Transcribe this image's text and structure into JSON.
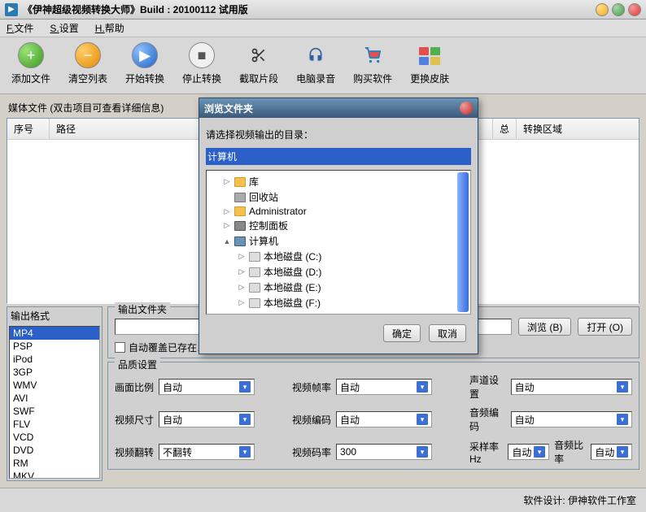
{
  "title": "《伊神超级视频转换大师》Build : 20100112 试用版",
  "menu": {
    "file": "文件",
    "settings": "设置",
    "help": "帮助",
    "f": "F.",
    "s": "S.",
    "h": "H."
  },
  "toolbar": {
    "add": "添加文件",
    "clear": "清空列表",
    "start": "开始转换",
    "stop": "停止转换",
    "cut": "截取片段",
    "record": "电脑录音",
    "buy": "购买软件",
    "skin": "更换皮肤"
  },
  "media": {
    "label": "媒体文件 (双击项目可查看详细信息)",
    "cols": {
      "c1": "序号",
      "c2": "路径",
      "c5": "总",
      "c6": "转换区域"
    }
  },
  "formats": {
    "title": "输出格式",
    "items": [
      "MP4",
      "PSP",
      "iPod",
      "3GP",
      "WMV",
      "AVI",
      "SWF",
      "FLV",
      "VCD",
      "DVD",
      "RM",
      "MKV"
    ],
    "selected": "MP4"
  },
  "output": {
    "group": "输出文件夹",
    "browse": "浏览 (B)",
    "open": "打开 (O)",
    "overwrite": "自动覆盖已存在…"
  },
  "quality": {
    "group": "品质设置",
    "aspect": "画面比例",
    "vfrate": "视频帧率",
    "channel": "声道设置",
    "vsize": "视频尺寸",
    "vcodec": "视频编码",
    "acodec": "音频编码",
    "rotate": "视频翻转",
    "vbitrate": "视频码率",
    "samplerate": "采样率Hz",
    "abitrate": "音频比率",
    "auto": "自动",
    "norotate": "不翻转",
    "br": "300"
  },
  "footer": "软件设计: 伊神软件工作室",
  "dialog": {
    "title": "浏览文件夹",
    "msg": "请选择视频输出的目录：",
    "selected": "计算机",
    "tree": {
      "lib": "库",
      "bin": "回收站",
      "admin": "Administrator",
      "ctrl": "控制面板",
      "pc": "计算机",
      "diskC": "本地磁盘 (C:)",
      "diskD": "本地磁盘 (D:)",
      "diskE": "本地磁盘 (E:)",
      "diskF": "本地磁盘 (F:)"
    },
    "ok": "确定",
    "cancel": "取消"
  }
}
